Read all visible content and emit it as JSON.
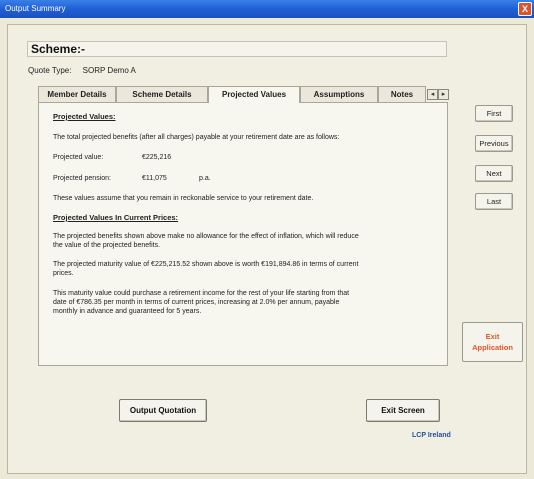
{
  "window": {
    "title": "Output Summary",
    "close": "X"
  },
  "scheme": {
    "label": "Scheme:-"
  },
  "quote_type": {
    "label": "Quote Type:",
    "value": "SORP Demo A"
  },
  "tabs": [
    {
      "label": "Member Details"
    },
    {
      "label": "Scheme Details"
    },
    {
      "label": "Projected Values"
    },
    {
      "label": "Assumptions"
    },
    {
      "label": "Notes"
    }
  ],
  "tab_scroll": {
    "left": "◂",
    "right": "▸"
  },
  "panel": {
    "heading1": "Projected Values:",
    "intro": "The total projected benefits (after all charges) payable at your retirement date are as follows:",
    "projected_value_label": "Projected value:",
    "projected_value": "€225,216",
    "projected_pension_label": "Projected pension:",
    "projected_pension": "€11,075",
    "pension_unit": "p.a.",
    "assume": "These values assume that you remain in reckonable service to your retirement date.",
    "heading2": "Projected Values In Current Prices:",
    "para1_line1": "The projected benefits shown above make no allowance for the effect of inflation, which will reduce",
    "para1_line2": "the value of the projected benefits.",
    "para2_line1": "The projected maturity value of €225,215.52 shown above is worth €191,894.86 in terms of current",
    "para2_line2": "prices.",
    "para3_line1": "This maturity value could purchase a retirement income for the rest of your life starting from that",
    "para3_line2": "date of €786.35 per month in terms of current prices, increasing at 2.0% per annum, payable",
    "para3_line3": "monthly in advance and guaranteed for 5 years."
  },
  "nav": {
    "first": "First",
    "previous": "Previous",
    "next": "Next",
    "last": "Last"
  },
  "exit_app": {
    "line1": "Exit",
    "line2": "Application"
  },
  "buttons": {
    "output_quotation": "Output Quotation",
    "exit_screen": "Exit Screen"
  },
  "brand": "LCP Ireland"
}
